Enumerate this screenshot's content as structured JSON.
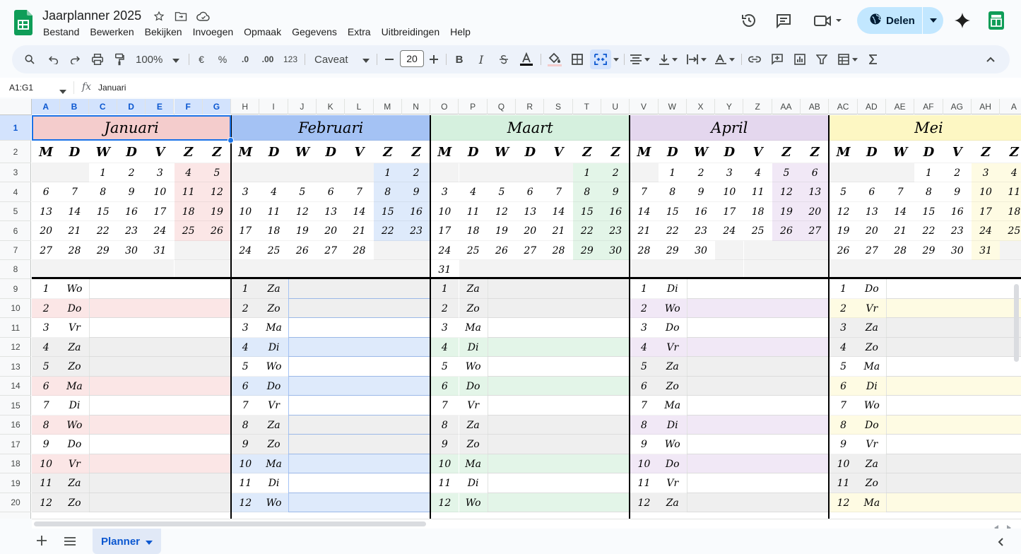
{
  "app": {
    "title": "Jaarplanner 2025"
  },
  "menu": [
    "Bestand",
    "Bewerken",
    "Bekijken",
    "Invoegen",
    "Opmaak",
    "Gegevens",
    "Extra",
    "Uitbreidingen",
    "Help"
  ],
  "share": {
    "label": "Delen"
  },
  "toolbar": {
    "zoom": "100%",
    "currency": "€",
    "percent": "%",
    "dec_less": ".0",
    "dec_more": ".00",
    "format123": "123",
    "font": "Caveat",
    "font_size": "20",
    "bold": "B",
    "italic": "I"
  },
  "formula_bar": {
    "name_box": "A1:G1",
    "fx": "fx",
    "value": "Januari"
  },
  "columns": [
    "A",
    "B",
    "C",
    "D",
    "E",
    "F",
    "G",
    "H",
    "I",
    "J",
    "K",
    "L",
    "M",
    "N",
    "O",
    "P",
    "Q",
    "R",
    "S",
    "T",
    "U",
    "V",
    "W",
    "X",
    "Y",
    "Z",
    "AA",
    "AB",
    "AC",
    "AD",
    "AE",
    "AF",
    "AG",
    "AH",
    "A"
  ],
  "rows": [
    "1",
    "2",
    "3",
    "4",
    "5",
    "6",
    "7",
    "8",
    "9",
    "10",
    "11",
    "12",
    "13",
    "14",
    "15",
    "16",
    "17",
    "18",
    "19",
    "20"
  ],
  "weekday_letters": [
    "M",
    "D",
    "W",
    "D",
    "V",
    "Z",
    "Z"
  ],
  "months": [
    {
      "name": "Januari",
      "color": "#f4cccc",
      "light": "#fbe6e6",
      "start": 2,
      "days": 31,
      "list_days": [
        "Wo",
        "Do",
        "Vr",
        "Za",
        "Zo",
        "Ma",
        "Di",
        "Wo",
        "Do",
        "Vr",
        "Za",
        "Zo"
      ]
    },
    {
      "name": "Februari",
      "color": "#a4c2f4",
      "light": "#deeafb",
      "start": 5,
      "days": 28,
      "list_days": [
        "Za",
        "Zo",
        "Ma",
        "Di",
        "Wo",
        "Do",
        "Vr",
        "Za",
        "Zo",
        "Ma",
        "Di",
        "Wo"
      ]
    },
    {
      "name": "Maart",
      "color": "#d5f0de",
      "light": "#e3f5e8",
      "start": 5,
      "days": 31,
      "list_days": [
        "Za",
        "Zo",
        "Ma",
        "Di",
        "Wo",
        "Do",
        "Vr",
        "Za",
        "Zo",
        "Ma",
        "Di",
        "Wo"
      ]
    },
    {
      "name": "April",
      "color": "#e4d7ee",
      "light": "#f1e8f6",
      "start": 1,
      "days": 30,
      "list_days": [
        "Di",
        "Wo",
        "Do",
        "Vr",
        "Za",
        "Zo",
        "Ma",
        "Di",
        "Wo",
        "Do",
        "Vr",
        "Za"
      ]
    },
    {
      "name": "Mei",
      "color": "#fdf7c3",
      "light": "#fefbe3",
      "start": 3,
      "days": 31,
      "list_days": [
        "Do",
        "Vr",
        "Za",
        "Zo",
        "Ma",
        "Di",
        "Wo",
        "Do",
        "Vr",
        "Za",
        "Zo",
        "Ma"
      ]
    }
  ],
  "sheets": {
    "active": "Planner"
  }
}
